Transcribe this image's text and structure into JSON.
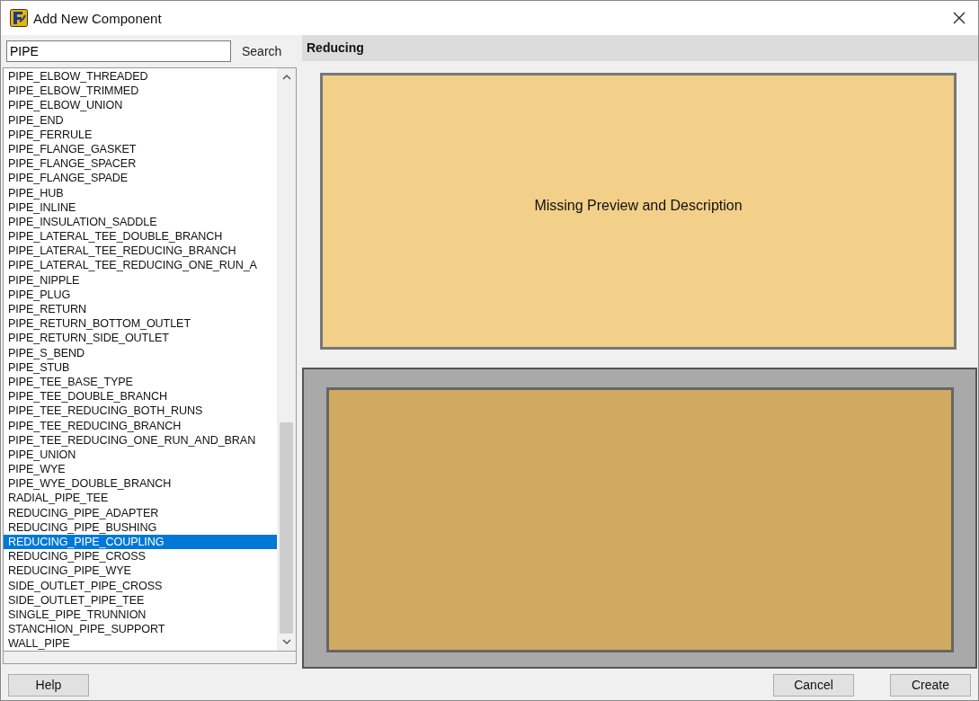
{
  "window": {
    "title": "Add New Component"
  },
  "search": {
    "value": "PIPE",
    "button": "Search"
  },
  "components": [
    {
      "label": "PIPE_ELBOW_THREADED",
      "selected": false
    },
    {
      "label": "PIPE_ELBOW_TRIMMED",
      "selected": false
    },
    {
      "label": "PIPE_ELBOW_UNION",
      "selected": false
    },
    {
      "label": "PIPE_END",
      "selected": false
    },
    {
      "label": "PIPE_FERRULE",
      "selected": false
    },
    {
      "label": "PIPE_FLANGE_GASKET",
      "selected": false
    },
    {
      "label": "PIPE_FLANGE_SPACER",
      "selected": false
    },
    {
      "label": "PIPE_FLANGE_SPADE",
      "selected": false
    },
    {
      "label": "PIPE_HUB",
      "selected": false
    },
    {
      "label": "PIPE_INLINE",
      "selected": false
    },
    {
      "label": "PIPE_INSULATION_SADDLE",
      "selected": false
    },
    {
      "label": "PIPE_LATERAL_TEE_DOUBLE_BRANCH",
      "selected": false
    },
    {
      "label": "PIPE_LATERAL_TEE_REDUCING_BRANCH",
      "selected": false
    },
    {
      "label": "PIPE_LATERAL_TEE_REDUCING_ONE_RUN_A",
      "selected": false
    },
    {
      "label": "PIPE_NIPPLE",
      "selected": false
    },
    {
      "label": "PIPE_PLUG",
      "selected": false
    },
    {
      "label": "PIPE_RETURN",
      "selected": false
    },
    {
      "label": "PIPE_RETURN_BOTTOM_OUTLET",
      "selected": false
    },
    {
      "label": "PIPE_RETURN_SIDE_OUTLET",
      "selected": false
    },
    {
      "label": "PIPE_S_BEND",
      "selected": false
    },
    {
      "label": "PIPE_STUB",
      "selected": false
    },
    {
      "label": "PIPE_TEE_BASE_TYPE",
      "selected": false
    },
    {
      "label": "PIPE_TEE_DOUBLE_BRANCH",
      "selected": false
    },
    {
      "label": "PIPE_TEE_REDUCING_BOTH_RUNS",
      "selected": false
    },
    {
      "label": "PIPE_TEE_REDUCING_BRANCH",
      "selected": false
    },
    {
      "label": "PIPE_TEE_REDUCING_ONE_RUN_AND_BRAN",
      "selected": false
    },
    {
      "label": "PIPE_UNION",
      "selected": false
    },
    {
      "label": "PIPE_WYE",
      "selected": false
    },
    {
      "label": "PIPE_WYE_DOUBLE_BRANCH",
      "selected": false
    },
    {
      "label": "RADIAL_PIPE_TEE",
      "selected": false
    },
    {
      "label": "REDUCING_PIPE_ADAPTER",
      "selected": false
    },
    {
      "label": "REDUCING_PIPE_BUSHING",
      "selected": false
    },
    {
      "label": "REDUCING_PIPE_COUPLING",
      "selected": true
    },
    {
      "label": "REDUCING_PIPE_CROSS",
      "selected": false
    },
    {
      "label": "REDUCING_PIPE_WYE",
      "selected": false
    },
    {
      "label": "SIDE_OUTLET_PIPE_CROSS",
      "selected": false
    },
    {
      "label": "SIDE_OUTLET_PIPE_TEE",
      "selected": false
    },
    {
      "label": "SINGLE_PIPE_TRUNNION",
      "selected": false
    },
    {
      "label": "STANCHION_PIPE_SUPPORT",
      "selected": false
    },
    {
      "label": "WALL_PIPE",
      "selected": false
    }
  ],
  "preview": {
    "header": "Reducing",
    "message": "Missing Preview and Description"
  },
  "buttons": {
    "help": "Help",
    "cancel": "Cancel",
    "create": "Create"
  }
}
